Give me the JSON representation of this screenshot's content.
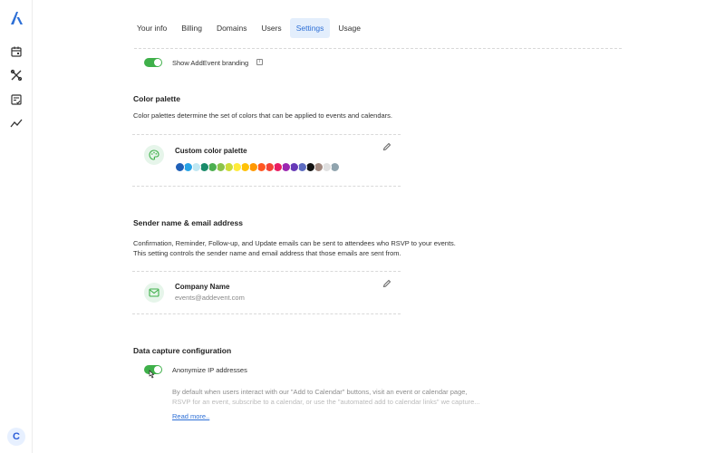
{
  "sidebar": {
    "logo": "addevent-logo",
    "icons": [
      "calendar-icon",
      "tools-icon",
      "checklist-icon",
      "analytics-icon"
    ],
    "avatar_initial": "C"
  },
  "tabs": [
    {
      "label": "Your info",
      "active": false
    },
    {
      "label": "Billing",
      "active": false
    },
    {
      "label": "Domains",
      "active": false
    },
    {
      "label": "Users",
      "active": false
    },
    {
      "label": "Settings",
      "active": true
    },
    {
      "label": "Usage",
      "active": false
    }
  ],
  "branding": {
    "label": "Show AddEvent branding",
    "enabled": true,
    "icon": "info-icon"
  },
  "color_palette": {
    "title": "Color palette",
    "description": "Color palettes determine the set of colors that can be applied to events and calendars.",
    "card_title": "Custom color palette",
    "swatches": [
      "#1f5fb7",
      "#28a4e6",
      "#bfe7f2",
      "#1a8b6a",
      "#4caf50",
      "#8bc34a",
      "#cddc39",
      "#ffeb3b",
      "#ffc107",
      "#ff9800",
      "#ff5722",
      "#f44336",
      "#e91e63",
      "#9c27b0",
      "#673ab7",
      "#5c6bc0",
      "#111111",
      "#a1887f",
      "#e0e0e0",
      "#90a4ae"
    ]
  },
  "sender": {
    "title": "Sender name & email address",
    "description_line1": "Confirmation, Reminder, Follow-up, and Update emails can be sent to attendees who RSVP to your events.",
    "description_line2": "This setting controls the sender name and email address that those emails are sent from.",
    "name": "Company Name",
    "email": "events@addevent.com"
  },
  "data_capture": {
    "title": "Data capture configuration",
    "toggle_label": "Anonymize IP addresses",
    "enabled": true,
    "text_line1": "By default when users interact with our \"Add to Calendar\" buttons, visit an event or calendar page,",
    "text_line2": "RSVP for an event, subscribe to a calendar, or use the \"automated add to calendar links\" we capture...",
    "read_more": "Read more.."
  }
}
